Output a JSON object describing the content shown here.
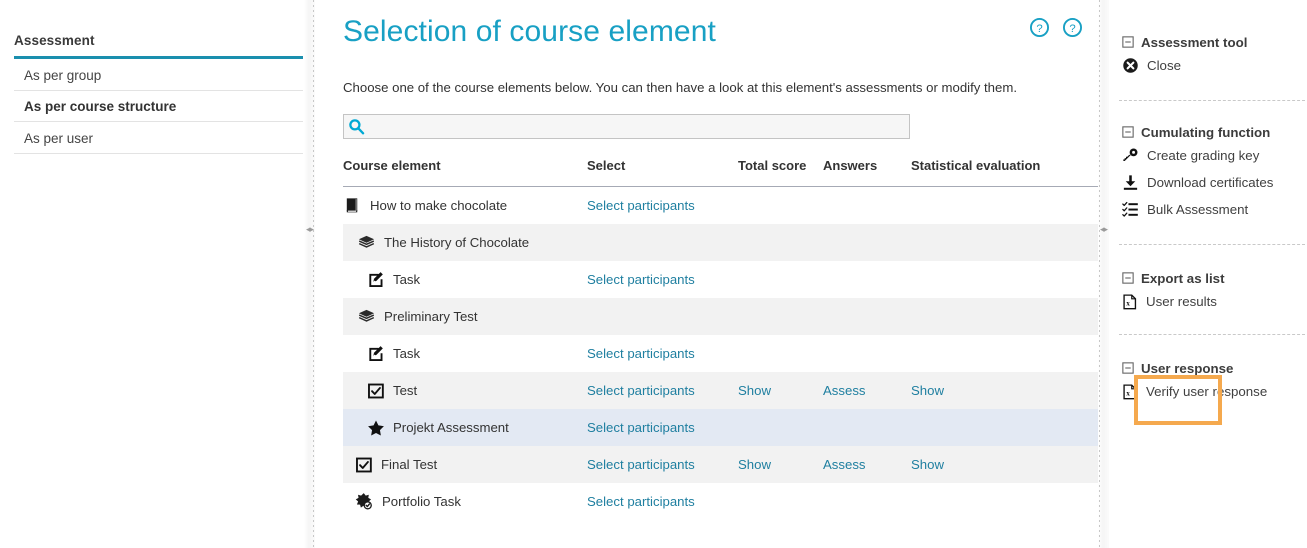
{
  "left_sidebar": {
    "title": "Assessment",
    "items": [
      {
        "label": "As per group",
        "active": false
      },
      {
        "label": "As per course structure",
        "active": true
      },
      {
        "label": "As per user",
        "active": false
      }
    ]
  },
  "main": {
    "title": "Selection of course element",
    "intro": "Choose one of the course elements below. You can then have a look at this element's assessments or modify them.",
    "search": {
      "value": "",
      "placeholder": ""
    },
    "help_icons": [
      "help-circle-icon",
      "help-circle-icon"
    ],
    "table": {
      "headers": {
        "element": "Course element",
        "select": "Select",
        "total": "Total score",
        "answers": "Answers",
        "stat": "Statistical evaluation"
      },
      "rows": [
        {
          "name": "How to make chocolate",
          "icon": "course-book-icon",
          "indent": 0,
          "select": "Select participants",
          "total": "",
          "answers": "",
          "stat": "",
          "style": "plain"
        },
        {
          "name": "The History of Chocolate",
          "icon": "structure-layers-icon",
          "indent": 1,
          "select": "",
          "total": "",
          "answers": "",
          "stat": "",
          "style": "alt"
        },
        {
          "name": "Task",
          "icon": "task-pencil-icon",
          "indent": 2,
          "select": "Select participants",
          "total": "",
          "answers": "",
          "stat": "",
          "style": "plain"
        },
        {
          "name": "Preliminary Test",
          "icon": "structure-layers-icon",
          "indent": 1,
          "select": "",
          "total": "",
          "answers": "",
          "stat": "",
          "style": "alt"
        },
        {
          "name": "Task",
          "icon": "task-pencil-icon",
          "indent": 2,
          "select": "Select participants",
          "total": "",
          "answers": "",
          "stat": "",
          "style": "plain"
        },
        {
          "name": "Test",
          "icon": "test-checkbox-icon",
          "indent": 2,
          "select": "Select participants",
          "total": "Show",
          "answers": "Assess",
          "stat": "Show",
          "style": "alt"
        },
        {
          "name": "Projekt Assessment",
          "icon": "assessment-star-icon",
          "indent": 2,
          "select": "Select participants",
          "total": "",
          "answers": "",
          "stat": "",
          "style": "sel"
        },
        {
          "name": "Final Test",
          "icon": "test-checkbox-icon",
          "indent": 3,
          "select": "Select participants",
          "total": "Show",
          "answers": "Assess",
          "stat": "Show",
          "style": "alt"
        },
        {
          "name": "Portfolio Task",
          "icon": "portfolio-task-icon",
          "indent": 3,
          "select": "Select participants",
          "total": "",
          "answers": "",
          "stat": "",
          "style": "plain"
        }
      ]
    },
    "highlight": {
      "target": "Assess",
      "color": "#f5a94e"
    }
  },
  "right_sidebar": {
    "groups": [
      {
        "title": "Assessment tool",
        "items": [
          {
            "label": "Close",
            "icon": "close-circle-icon"
          }
        ]
      },
      {
        "title": "Cumulating function",
        "items": [
          {
            "label": "Create grading key",
            "icon": "key-icon"
          },
          {
            "label": "Download certificates",
            "icon": "download-icon"
          },
          {
            "label": "Bulk Assessment",
            "icon": "checklist-icon"
          }
        ]
      },
      {
        "title": "Export as list",
        "items": [
          {
            "label": "User results",
            "icon": "excel-file-icon"
          }
        ]
      },
      {
        "title": "User response",
        "items": [
          {
            "label": "Verify user response",
            "icon": "excel-file-icon"
          }
        ]
      }
    ]
  },
  "colors": {
    "accent": "#18a0c4",
    "link": "#1f7fa0",
    "tab_underline": "#1a8fae",
    "highlight": "#f5a94e",
    "row_alt": "#f2f2f2",
    "row_selected": "#e3e9f3"
  }
}
